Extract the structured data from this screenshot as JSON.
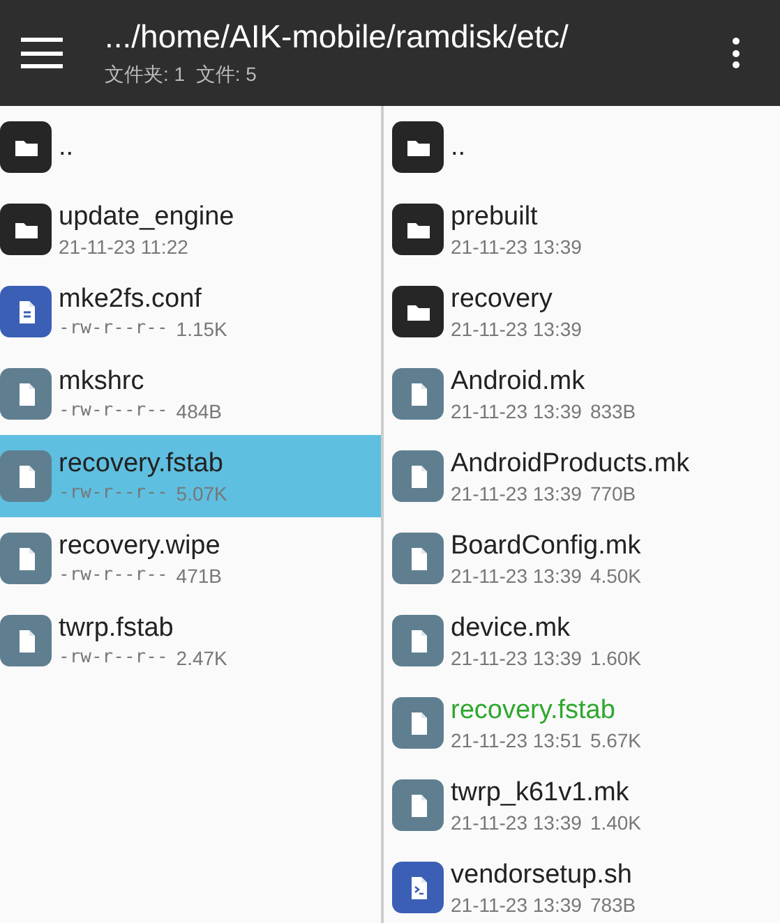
{
  "toolbar": {
    "path": ".../home/AIK-mobile/ramdisk/etc/",
    "summary": "文件夹: 1  文件: 5"
  },
  "left_panel": {
    "items": [
      {
        "kind": "folder",
        "name": "..",
        "selected": false
      },
      {
        "kind": "folder",
        "name": "update_engine",
        "date": "21-11-23 11:22",
        "selected": false
      },
      {
        "kind": "document",
        "name": "mke2fs.conf",
        "permissions": "-rw-r--r--",
        "size": "1.15K",
        "selected": false
      },
      {
        "kind": "file",
        "name": "mkshrc",
        "permissions": "-rw-r--r--",
        "size": "484B",
        "selected": false
      },
      {
        "kind": "file",
        "name": "recovery.fstab",
        "permissions": "-rw-r--r--",
        "size": "5.07K",
        "selected": true
      },
      {
        "kind": "file",
        "name": "recovery.wipe",
        "permissions": "-rw-r--r--",
        "size": "471B",
        "selected": false
      },
      {
        "kind": "file",
        "name": "twrp.fstab",
        "permissions": "-rw-r--r--",
        "size": "2.47K",
        "selected": false
      }
    ]
  },
  "right_panel": {
    "items": [
      {
        "kind": "folder",
        "name": "..",
        "highlighted": false
      },
      {
        "kind": "folder",
        "name": "prebuilt",
        "date": "21-11-23 13:39",
        "highlighted": false
      },
      {
        "kind": "folder",
        "name": "recovery",
        "date": "21-11-23 13:39",
        "highlighted": false
      },
      {
        "kind": "file",
        "name": "Android.mk",
        "date": "21-11-23 13:39",
        "size": "833B",
        "highlighted": false
      },
      {
        "kind": "file",
        "name": "AndroidProducts.mk",
        "date": "21-11-23 13:39",
        "size": "770B",
        "highlighted": false
      },
      {
        "kind": "file",
        "name": "BoardConfig.mk",
        "date": "21-11-23 13:39",
        "size": "4.50K",
        "highlighted": false
      },
      {
        "kind": "file",
        "name": "device.mk",
        "date": "21-11-23 13:39",
        "size": "1.60K",
        "highlighted": false
      },
      {
        "kind": "file",
        "name": "recovery.fstab",
        "date": "21-11-23 13:51",
        "size": "5.67K",
        "highlighted": true
      },
      {
        "kind": "file",
        "name": "twrp_k61v1.mk",
        "date": "21-11-23 13:39",
        "size": "1.40K",
        "highlighted": false
      },
      {
        "kind": "script",
        "name": "vendorsetup.sh",
        "date": "21-11-23 13:39",
        "size": "783B",
        "highlighted": false
      }
    ]
  }
}
